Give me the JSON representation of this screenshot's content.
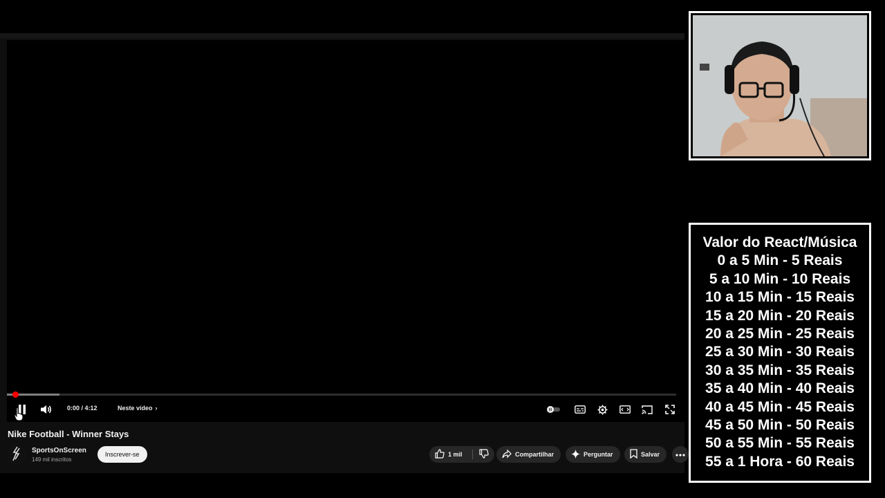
{
  "player": {
    "time_display": "0:00 / 4:12",
    "chapter_label": "Neste vídeo",
    "progress_fraction": 0.0,
    "buffered_fraction": 0.078,
    "accent_color": "#ff0000",
    "icons": {
      "play_pause": "pause-icon",
      "volume": "volume-icon",
      "autoplay": "autoplay-toggle-icon",
      "captions": "captions-icon",
      "settings": "gear-icon",
      "theater": "theater-mode-icon",
      "cast": "cast-icon",
      "fullscreen": "fullscreen-icon"
    }
  },
  "video": {
    "title": "Nike Football - Winner Stays"
  },
  "channel": {
    "name": "SportsOnScreen",
    "subscribers": "149 mil inscritos",
    "subscribe_label": "Inscrever-se"
  },
  "actions": {
    "like_count": "1 mil",
    "share_label": "Compartilhar",
    "ask_label": "Perguntar",
    "save_label": "Salvar"
  },
  "price_table": {
    "lines": [
      "Valor do React/Música",
      "0 a 5 Min - 5 Reais",
      "5 a 10 Min - 10 Reais",
      "10 a 15 Min - 15 Reais",
      "15 a 20 Min - 20 Reais",
      "20 a 25 Min - 25 Reais",
      "25 a 30 Min - 30 Reais",
      "30 a 35 Min - 35 Reais",
      "35 a 40 Min - 40 Reais",
      "40 a 45 Min - 45 Reais",
      "45 a 50 Min - 50 Reais",
      "50 a 55 Min - 55 Reais",
      "55 a 1 Hora - 60 Reais"
    ]
  }
}
